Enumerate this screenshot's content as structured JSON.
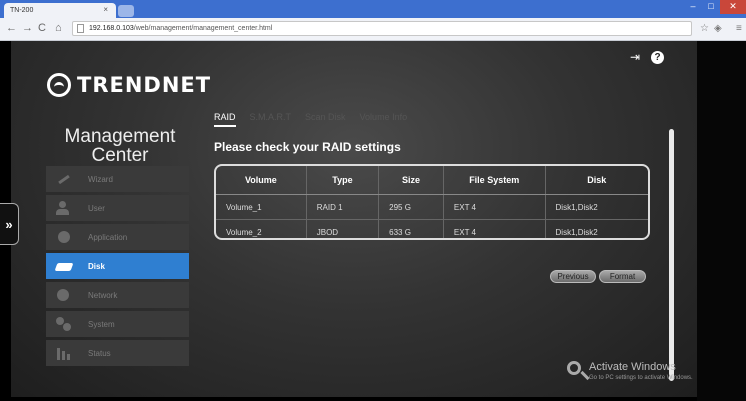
{
  "browser": {
    "tab_title": "TN-200",
    "tab_close": "×",
    "url_host": "192.168.0.103",
    "url_path": "/web/management/management_center.html",
    "back_icon": "back-arrow-icon",
    "forward_icon": "forward-arrow-icon",
    "reload_icon": "reload-icon",
    "home_icon": "home-icon"
  },
  "header": {
    "logo_text": "TRENDNET"
  },
  "sidebar": {
    "title": "Management Center",
    "items": [
      {
        "label": "Wizard",
        "icon": "wizard-icon",
        "active": false
      },
      {
        "label": "User",
        "icon": "user-icon",
        "active": false
      },
      {
        "label": "Application",
        "icon": "application-icon",
        "active": false
      },
      {
        "label": "Disk",
        "icon": "disk-icon",
        "active": true
      },
      {
        "label": "Network",
        "icon": "network-icon",
        "active": false
      },
      {
        "label": "System",
        "icon": "system-icon",
        "active": false
      },
      {
        "label": "Status",
        "icon": "status-icon",
        "active": false
      }
    ],
    "expand_label": "»"
  },
  "main": {
    "tabs": [
      {
        "label": "RAID",
        "active": true
      },
      {
        "label": "S.M.A.R.T",
        "active": false
      },
      {
        "label": "Scan Disk",
        "active": false
      },
      {
        "label": "Volume Info",
        "active": false
      }
    ],
    "section_title": "Please check your RAID settings",
    "table": {
      "columns": [
        "Volume",
        "Type",
        "Size",
        "File System",
        "Disk"
      ],
      "rows": [
        [
          "Volume_1",
          "RAID 1",
          "295 G",
          "EXT 4",
          "Disk1,Disk2"
        ],
        [
          "Volume_2",
          "JBOD",
          "633 G",
          "EXT 4",
          "Disk1,Disk2"
        ]
      ]
    },
    "buttons": {
      "previous": "Previous",
      "format": "Format"
    }
  },
  "watermark": {
    "title": "Activate Windows",
    "subtitle": "Go to PC settings to activate Windows."
  },
  "colors": {
    "accent": "#2f7fd1",
    "browser_tabbar": "#3d6fcf"
  }
}
